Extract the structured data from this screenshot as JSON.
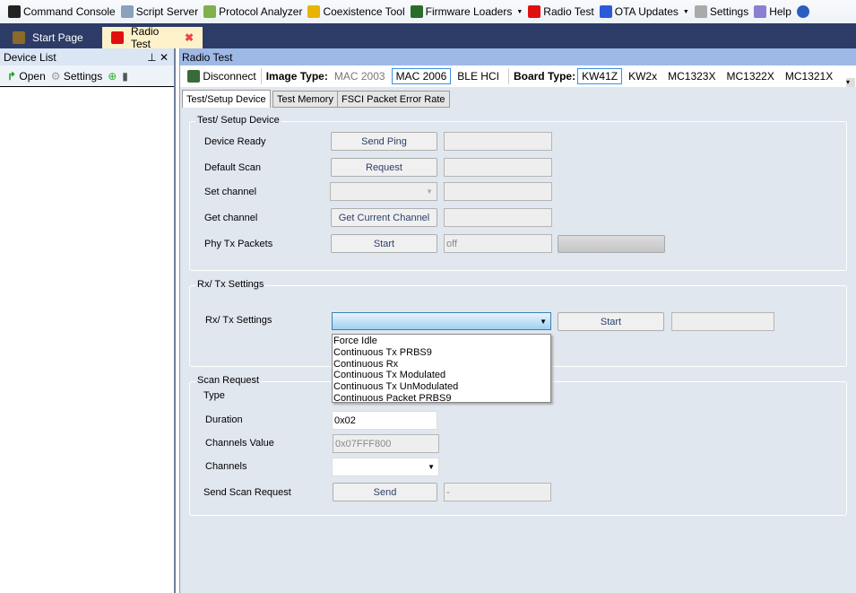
{
  "menu": [
    {
      "label": "Command Console",
      "icon": "console-icon",
      "color": "#222"
    },
    {
      "label": "Script Server",
      "icon": "server-icon",
      "color": "#8aa0bb"
    },
    {
      "label": "Protocol Analyzer",
      "icon": "analyzer-icon",
      "color": "#7fb04a"
    },
    {
      "label": "Coexistence Tool",
      "icon": "coexistence-icon",
      "color": "#e8b400"
    },
    {
      "label": "Firmware Loaders",
      "icon": "chip-icon",
      "color": "#2a6d2a",
      "dropdown": true
    },
    {
      "label": "Radio Test",
      "icon": "radio-test-icon",
      "color": "#e01010"
    },
    {
      "label": "OTA Updates",
      "icon": "ota-icon",
      "color": "#2c5bd8",
      "dropdown": true
    },
    {
      "label": "Settings",
      "icon": "gear-icon",
      "color": "#aaa"
    },
    {
      "label": "Help",
      "icon": "book-icon",
      "color": "#8a7fd0"
    },
    {
      "label": "",
      "icon": "question-icon",
      "color": "#2a5ec0"
    }
  ],
  "doc_tabs": [
    {
      "label": "Start Page"
    },
    {
      "label": "Radio Test"
    }
  ],
  "device_list": {
    "title": "Device List",
    "open": "Open",
    "settings": "Settings"
  },
  "radio_test": {
    "title": "Radio Test",
    "disconnect": "Disconnect",
    "image_type_label": "Image Type:",
    "image_types": [
      "MAC 2003",
      "MAC 2006",
      "BLE HCI"
    ],
    "board_type_label": "Board Type:",
    "board_types": [
      "KW41Z",
      "KW2x",
      "MC1323X",
      "MC1322X",
      "MC1321X"
    ],
    "tabs": [
      "Test/Setup Device",
      "Test Memory",
      "FSCI Packet Error Rate"
    ],
    "setup": {
      "title": "Test/ Setup Device",
      "rows": [
        {
          "label": "Device Ready",
          "button": "Send Ping",
          "value": ""
        },
        {
          "label": "Default Scan",
          "button": "Request",
          "value": ""
        },
        {
          "label": "Set channel",
          "button": "",
          "value": ""
        },
        {
          "label": "Get channel",
          "button": "Get Current Channel",
          "value": ""
        },
        {
          "label": "Phy Tx Packets",
          "button": "Start",
          "value": "off"
        }
      ]
    },
    "rxtx": {
      "title": "Rx/ Tx Settings",
      "label": "Rx/ Tx Settings",
      "start": "Start",
      "options": [
        "Force Idle",
        "Continuous Tx PRBS9",
        "Continuous Rx",
        "Continuous Tx Modulated",
        "Continuous Tx UnModulated",
        "Continuous Packet PRBS9"
      ]
    },
    "scan": {
      "title": "Scan Request",
      "type_label": "Type",
      "duration_label": "Duration",
      "duration": "0x02",
      "channels_value_label": "Channels Value",
      "channels_value": "0x07FFF800",
      "channels_label": "Channels",
      "send_label": "Send Scan Request",
      "send": "Send",
      "result": "-"
    }
  }
}
